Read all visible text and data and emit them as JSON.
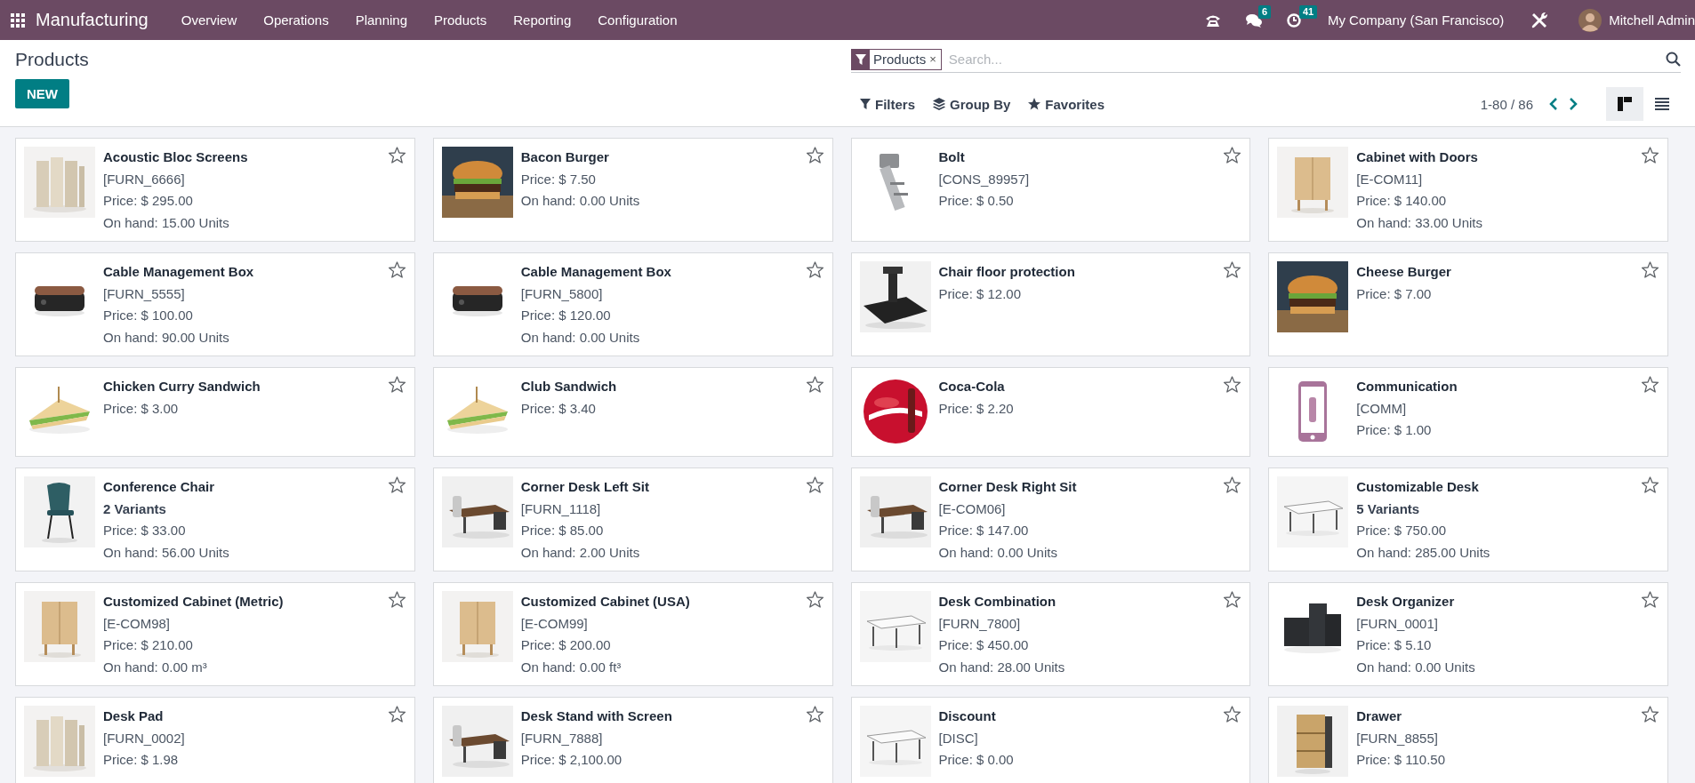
{
  "navbar": {
    "app": "Manufacturing",
    "menus": [
      "Overview",
      "Operations",
      "Planning",
      "Products",
      "Reporting",
      "Configuration"
    ],
    "messages_badge": "6",
    "activities_badge": "41",
    "company": "My Company (San Francisco)",
    "user": "Mitchell Admin"
  },
  "control_panel": {
    "title": "Products",
    "new_button": "NEW",
    "facet": {
      "label": "Products",
      "remove": "×"
    },
    "search": {
      "placeholder": "Search..."
    },
    "buttons": [
      "Filters",
      "Group By",
      "Favorites"
    ],
    "pager": "1-80 / 86",
    "views": [
      {
        "kind": "kanban",
        "selected": true
      },
      {
        "kind": "list",
        "selected": false
      }
    ]
  },
  "cards": [
    {
      "name": "Acoustic Bloc Screens",
      "ref": "[FURN_6666]",
      "price": "Price: $ 295.00",
      "on_hand": "On hand: 15.00 Units",
      "favorite": false
    },
    {
      "name": "Bacon Burger",
      "price": "Price: $ 7.50",
      "on_hand": "On hand: 0.00 Units",
      "favorite": false
    },
    {
      "name": "Bolt",
      "ref": "[CONS_89957]",
      "price": "Price: $ 0.50",
      "favorite": false
    },
    {
      "name": "Cabinet with Doors",
      "ref": "[E-COM11]",
      "price": "Price: $ 140.00",
      "on_hand": "On hand: 33.00 Units",
      "favorite": false
    },
    {
      "name": "Cable Management Box",
      "ref": "[FURN_5555]",
      "price": "Price: $ 100.00",
      "on_hand": "On hand: 90.00 Units",
      "favorite": false
    },
    {
      "name": "Cable Management Box",
      "ref": "[FURN_5800]",
      "price": "Price: $ 120.00",
      "on_hand": "On hand: 0.00 Units",
      "favorite": false
    },
    {
      "name": "Chair floor protection",
      "price": "Price: $ 12.00",
      "favorite": false
    },
    {
      "name": "Cheese Burger",
      "price": "Price: $ 7.00",
      "favorite": false
    },
    {
      "name": "Chicken Curry Sandwich",
      "price": "Price: $ 3.00",
      "favorite": false
    },
    {
      "name": "Club Sandwich",
      "price": "Price: $ 3.40",
      "favorite": false
    },
    {
      "name": "Coca-Cola",
      "price": "Price: $ 2.20",
      "favorite": false
    },
    {
      "name": "Communication",
      "ref": "[COMM]",
      "price": "Price: $ 1.00",
      "favorite": false
    },
    {
      "name": "Conference Chair",
      "variants": "2 Variants",
      "price": "Price: $ 33.00",
      "on_hand": "On hand: 56.00 Units",
      "favorite": false
    },
    {
      "name": "Corner Desk Left Sit",
      "ref": "[FURN_1118]",
      "price": "Price: $ 85.00",
      "on_hand": "On hand: 2.00 Units",
      "favorite": false
    },
    {
      "name": "Corner Desk Right Sit",
      "ref": "[E-COM06]",
      "price": "Price: $ 147.00",
      "on_hand": "On hand: 0.00 Units",
      "favorite": false
    },
    {
      "name": "Customizable Desk",
      "variants": "5 Variants",
      "price": "Price: $ 750.00",
      "on_hand": "On hand: 285.00 Units",
      "favorite": false
    },
    {
      "name": "Customized Cabinet (Metric)",
      "ref": "[E-COM98]",
      "price": "Price: $ 210.00",
      "on_hand": "On hand: 0.00 m³",
      "favorite": false
    },
    {
      "name": "Customized Cabinet (USA)",
      "ref": "[E-COM99]",
      "price": "Price: $ 200.00",
      "on_hand": "On hand: 0.00 ft³",
      "favorite": false
    },
    {
      "name": "Desk Combination",
      "ref": "[FURN_7800]",
      "price": "Price: $ 450.00",
      "on_hand": "On hand: 28.00 Units",
      "favorite": false
    },
    {
      "name": "Desk Organizer",
      "ref": "[FURN_0001]",
      "price": "Price: $ 5.10",
      "on_hand": "On hand: 0.00 Units",
      "favorite": false
    },
    {
      "name": "Desk Pad",
      "ref": "[FURN_0002]",
      "price": "Price: $ 1.98",
      "favorite": false
    },
    {
      "name": "Desk Stand with Screen",
      "ref": "[FURN_7888]",
      "price": "Price: $ 2,100.00",
      "favorite": false
    },
    {
      "name": "Discount",
      "ref": "[DISC]",
      "price": "Price: $ 0.00",
      "favorite": false
    },
    {
      "name": "Drawer",
      "ref": "[FURN_8855]",
      "price": "Price: $ 110.50",
      "favorite": false
    }
  ]
}
